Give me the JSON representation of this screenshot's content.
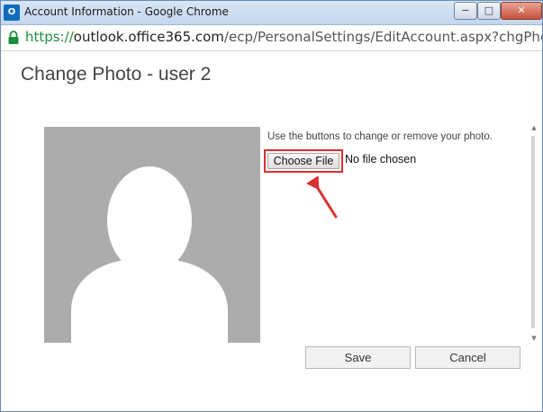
{
  "window": {
    "title": "Account Information - Google Chrome",
    "app_icon_label": "O",
    "minimize_glyph": "−",
    "maximize_glyph": "□",
    "close_glyph": "✕"
  },
  "address_bar": {
    "scheme": "https://",
    "host": "outlook.office365.com",
    "path": "/ecp/PersonalSettings/EditAccount.aspx?chgPhoto=",
    "secure": true
  },
  "dialog": {
    "title": "Change Photo - user 2",
    "instructions": "Use the buttons to change or remove your photo.",
    "choose_file_label": "Choose File",
    "file_status": "No file chosen",
    "save_label": "Save",
    "cancel_label": "Cancel"
  },
  "scrollbar": {
    "up_glyph": "▲",
    "down_glyph": "▼"
  },
  "colors": {
    "highlight": "#d9312f",
    "avatar_bg": "#acacac",
    "avatar_silhouette": "#ffffff",
    "secure_scheme": "#1e8e3e",
    "annotation_arrow": "#d9312f"
  },
  "icons": {
    "app": "outlook-icon",
    "lock": "lock-icon",
    "avatar": "person-silhouette-icon",
    "annotation": "arrow-pointer-icon"
  }
}
